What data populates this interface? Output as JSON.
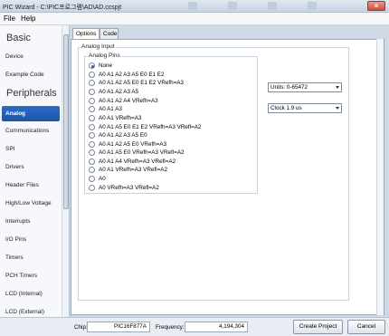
{
  "window": {
    "title": "PIC Wizard - C:\\PIC프로그램\\AD\\AD.ccspjt",
    "close_glyph": "×"
  },
  "menu": {
    "file": "File",
    "help": "Help"
  },
  "sidebar": {
    "sections": {
      "basic": "Basic",
      "peripherals": "Peripherals"
    },
    "items": [
      {
        "label": "Device"
      },
      {
        "label": "Example Code"
      },
      {
        "label": "Analog",
        "active": true
      },
      {
        "label": "Communications"
      },
      {
        "label": "SPI"
      },
      {
        "label": "Drivers"
      },
      {
        "label": "Header Files"
      },
      {
        "label": "High/Low Voltage"
      },
      {
        "label": "Interrupts"
      },
      {
        "label": "I/O Pins"
      },
      {
        "label": "Timers"
      },
      {
        "label": "PCH Timers"
      },
      {
        "label": "LCD (Internal)"
      },
      {
        "label": "LCD (External)"
      }
    ]
  },
  "tabs": [
    {
      "label": "Options",
      "active": true
    },
    {
      "label": "Code",
      "active": false
    }
  ],
  "analog": {
    "group_title": "Analog Input",
    "pins_title": "Analog Pins",
    "options": [
      "None",
      "A0 A1 A2 A3 A5 E0 E1 E2",
      "A0 A1 A2 A5 E0 E1 E2 VRefh=A3",
      "A0 A1 A2 A3 A5",
      "A0 A1 A2 A4 VRefh=A3",
      "A0 A1 A3",
      "A0 A1 VRefh=A3",
      "A0 A1 A5 E0 E1 E2 VRefh=A3 VRefl=A2",
      "A0 A1 A2 A3 A5 E0",
      "A0 A1 A2 A5 E0 VRefh=A3",
      "A0 A1 A5 E0 VRefh=A3 VRefl=A2",
      "A0 A1 A4 VRefh=A3 VRefl=A2",
      "A0 A1 VRefh=A3 VRefl=A2",
      "A0",
      "A0 VRefh=A3 VRefl=A2"
    ],
    "selected_index": 0,
    "units": "Units: 0-65472",
    "clock": "Clock 1.9 us"
  },
  "status": {
    "chip_label": "Chip:",
    "chip_value": "PIC16F877A",
    "freq_label": "Frequency:",
    "freq_value": "4,194,304",
    "create_label": "Create Project",
    "cancel_label": "Cancel"
  }
}
